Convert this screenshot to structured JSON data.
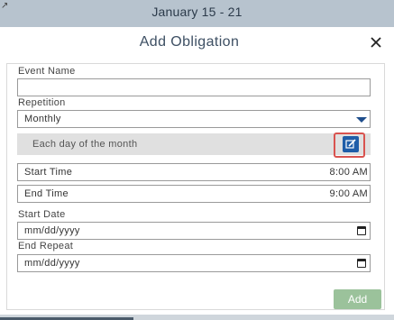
{
  "header": {
    "week_label": "January 15 - 21",
    "cursor_icon": "pointer-cursor-icon"
  },
  "dialog": {
    "title": "Add Obligation",
    "close_icon": "close-icon",
    "event_name": {
      "label": "Event Name",
      "value": ""
    },
    "repetition": {
      "label": "Repetition",
      "selected": "Monthly",
      "caret_color": "#1f4e8c"
    },
    "repeat_rule": {
      "text": "Each day of the month",
      "edit_icon": "pencil-edit-icon",
      "edit_color": "#1f5da8",
      "highlight_color": "#d9534f"
    },
    "start_time": {
      "label": "Start Time",
      "value": "8:00 AM"
    },
    "end_time": {
      "label": "End Time",
      "value": "9:00 AM"
    },
    "start_date": {
      "label": "Start Date",
      "placeholder": "mm/dd/yyyy",
      "icon": "calendar-icon"
    },
    "end_repeat": {
      "label": "End Repeat",
      "placeholder": "mm/dd/yyyy",
      "icon": "calendar-icon"
    },
    "add_button": {
      "label": "Add",
      "color": "#9bc29b"
    }
  }
}
